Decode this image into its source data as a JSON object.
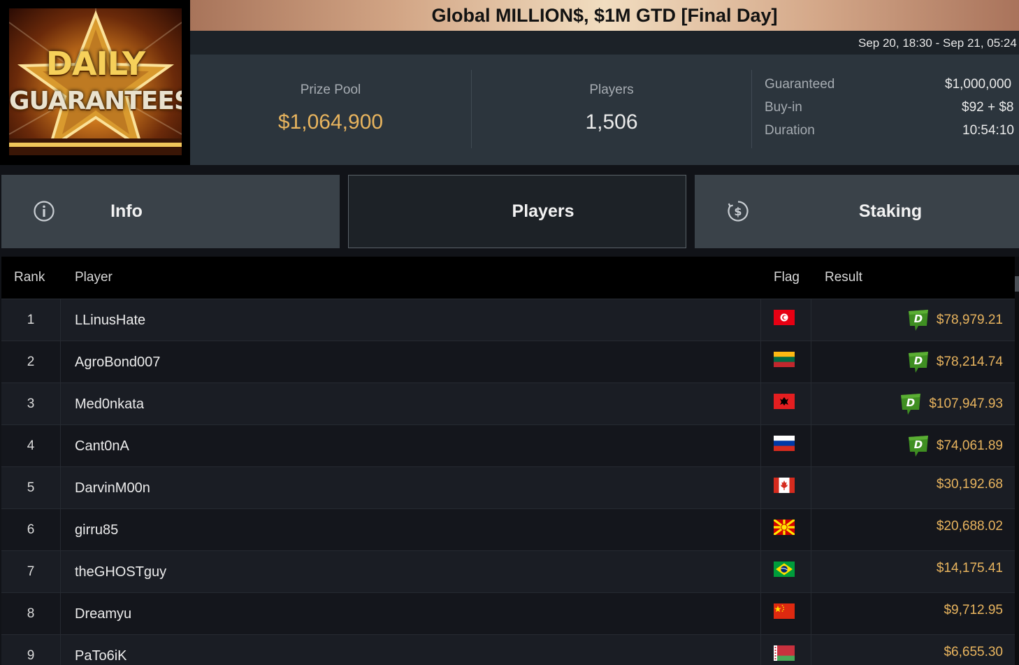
{
  "header": {
    "logo_line1": "DAILY",
    "logo_line2": "GUARANTEES",
    "title": "Global MILLION$, $1M GTD [Final Day]",
    "dates": "Sep 20, 18:30 - Sep 21, 05:24"
  },
  "stats": {
    "prize_pool_label": "Prize Pool",
    "prize_pool_value": "$1,064,900",
    "players_label": "Players",
    "players_value": "1,506",
    "details": [
      {
        "key": "Guaranteed",
        "value": "$1,000,000"
      },
      {
        "key": "Buy-in",
        "value": "$92 + $8"
      },
      {
        "key": "Duration",
        "value": "10:54:10"
      }
    ]
  },
  "tabs": {
    "info": {
      "label": "Info",
      "icon": "info-icon"
    },
    "players": {
      "label": "Players",
      "active": true
    },
    "staking": {
      "label": "Staking",
      "icon": "dollar-circle-icon"
    }
  },
  "table": {
    "headers": {
      "rank": "Rank",
      "player": "Player",
      "flag": "Flag",
      "result": "Result"
    },
    "rows": [
      {
        "rank": "1",
        "player": "LLinusHate",
        "flag": "tunisia",
        "result": "$78,979.21",
        "deal": true
      },
      {
        "rank": "2",
        "player": "AgroBond007",
        "flag": "lithuania",
        "result": "$78,214.74",
        "deal": true
      },
      {
        "rank": "3",
        "player": "Med0nkata",
        "flag": "albania",
        "result": "$107,947.93",
        "deal": true
      },
      {
        "rank": "4",
        "player": "Cant0nA",
        "flag": "russia",
        "result": "$74,061.89",
        "deal": true
      },
      {
        "rank": "5",
        "player": "DarvinM00n",
        "flag": "canada",
        "result": "$30,192.68",
        "deal": false
      },
      {
        "rank": "6",
        "player": "girru85",
        "flag": "north-macedonia",
        "result": "$20,688.02",
        "deal": false
      },
      {
        "rank": "7",
        "player": "theGHOSTguy",
        "flag": "brazil",
        "result": "$14,175.41",
        "deal": false
      },
      {
        "rank": "8",
        "player": "Dreamyu",
        "flag": "china",
        "result": "$9,712.95",
        "deal": false
      },
      {
        "rank": "9",
        "player": "PaTo6iK",
        "flag": "belarus",
        "result": "$6,655.30",
        "deal": false
      }
    ]
  },
  "colors": {
    "gold": "#e8b45e",
    "deal_badge": "#3f8f22",
    "panel": "#2c353d",
    "tab": "#3a4249"
  }
}
